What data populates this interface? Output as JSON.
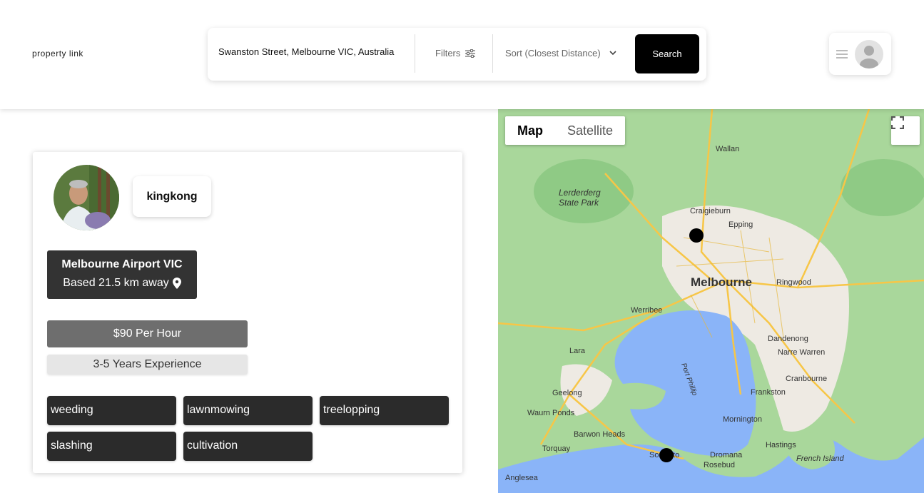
{
  "header": {
    "logo_text": "property  link",
    "search_value": "Swanston Street, Melbourne VIC, Australia",
    "filters_label": "Filters",
    "sort_label": "Sort (Closest Distance)",
    "search_button": "Search"
  },
  "listing": {
    "username": "kingkong",
    "location": "Melbourne Airport VIC",
    "distance": "Based 21.5 km away",
    "rate": "$90 Per Hour",
    "experience": "3-5 Years Experience",
    "tags": [
      "weeding",
      "lawnmowing",
      "treelopping",
      "slashing",
      "cultivation"
    ]
  },
  "map": {
    "map_button": "Map",
    "satellite_button": "Satellite",
    "labels": {
      "melbourne": "Melbourne",
      "lerderderg": "Lerderderg",
      "state_park": "State Park",
      "craigieburn": "Craigieburn",
      "epping": "Epping",
      "wallan": "Wallan",
      "ringwood": "Ringwood",
      "werribee": "Werribee",
      "lara": "Lara",
      "dandenong": "Dandenong",
      "narre_warren": "Narre Warren",
      "cranbourne": "Cranbourne",
      "frankston": "Frankston",
      "geelong": "Geelong",
      "waurn_ponds": "Waurn Ponds",
      "barwon_heads": "Barwon Heads",
      "torquay": "Torquay",
      "mornington": "Mornington",
      "sorrento": "Sorrento",
      "dromana": "Dromana",
      "rosebud": "Rosebud",
      "hastings": "Hastings",
      "french_island": "French Island",
      "anglesea": "Anglesea",
      "port_phillip": "Port Phillip"
    },
    "colors": {
      "land": "#a9d79b",
      "water": "#8ab4f8",
      "urban": "#eeeae3",
      "road": "#f7c647"
    }
  }
}
